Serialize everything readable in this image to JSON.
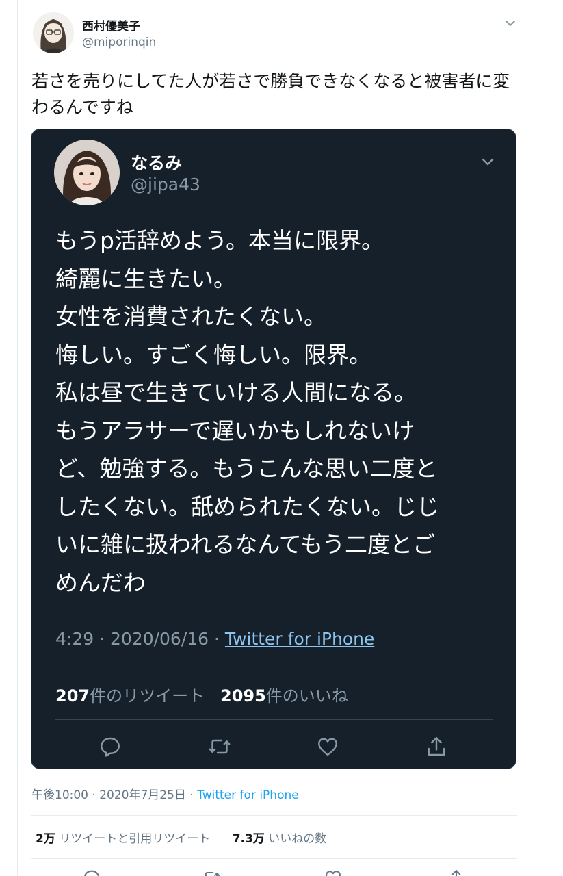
{
  "tweet": {
    "display_name": "西村優美子",
    "handle": "@miporinqin",
    "text": "若さを売りにしてた人が若さで勝負できなくなると被害者に変わるんですね",
    "time": "午後10:00",
    "sep": " · ",
    "date": "2020年7月25日",
    "source": "Twitter for iPhone",
    "retweet_count": "2万",
    "retweet_label": "リツイートと引用リツイート",
    "like_count": "7.3万",
    "like_label": "いいねの数"
  },
  "quoted_tweet": {
    "display_name": "なるみ",
    "handle": "@jipa43",
    "lines": [
      "もうp活辞めよう。本当に限界。",
      "綺麗に生きたい。",
      "女性を消費されたくない。",
      "悔しい。すごく悔しい。限界。",
      "私は昼で生きていける人間になる。",
      "もうアラサーで遅いかもしれないけ",
      "ど、勉強する。もうこんな思い二度と",
      "したくない。舐められたくない。じじ",
      "いに雑に扱われるなんてもう二度とご",
      "めんだわ"
    ],
    "time": "4:29",
    "sep": " · ",
    "date": "2020/06/16",
    "source": "Twitter for iPhone",
    "retweet_count": "207",
    "retweet_label": "件のリツイート",
    "like_count": "2095",
    "like_label": "件のいいね"
  },
  "icons": {
    "menu": "chevron-down-icon",
    "reply": "reply-icon",
    "retweet": "retweet-icon",
    "like": "heart-icon",
    "share": "share-icon"
  },
  "colors": {
    "dark_bg": "#15202b",
    "link_blue": "#1da1f2",
    "muted": "#657786",
    "dark_muted": "#8899a6"
  }
}
